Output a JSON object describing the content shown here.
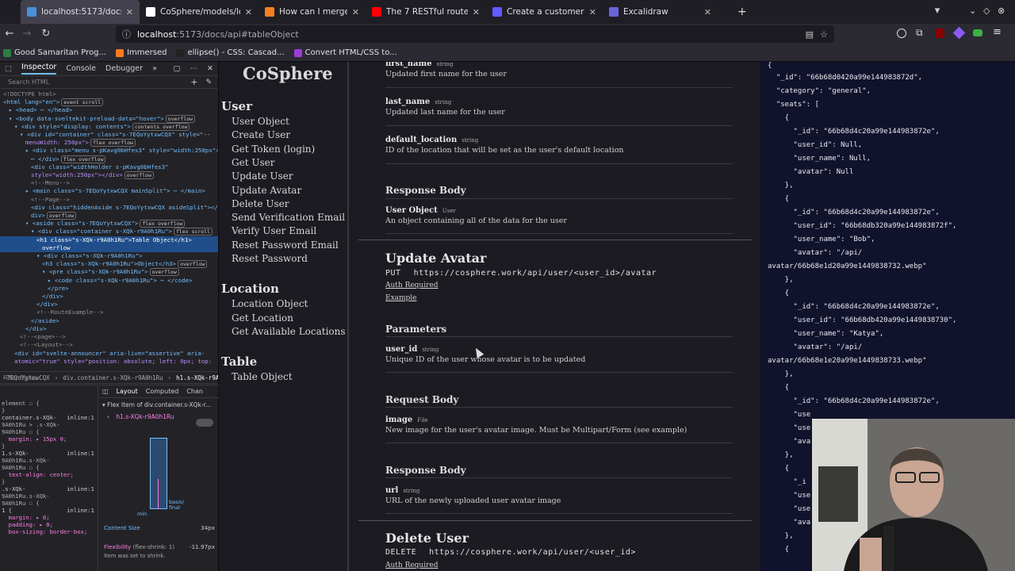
{
  "tabs": [
    {
      "title": "localhost:5173/docs/api#t",
      "color": "#4a90d9"
    },
    {
      "title": "CoSphere/models/location",
      "color": "#ffffff"
    },
    {
      "title": "How can I merge properti",
      "color": "#f48024"
    },
    {
      "title": "The 7 RESTful routes! Wha",
      "color": "#ff0000"
    },
    {
      "title": "Create a customer | Stripe",
      "color": "#635bff"
    },
    {
      "title": "Excalidraw",
      "color": "#6965db"
    }
  ],
  "url": {
    "host": "localhost",
    "path": ":5173/docs/api#tableObject"
  },
  "bookmarks": [
    "Good Samaritan Prog...",
    "Immersed",
    "ellipse() - CSS: Cascad...",
    "Convert HTML/CSS to..."
  ],
  "devtools": {
    "tabs": [
      "Inspector",
      "Console",
      "Debugger"
    ],
    "search_placeholder": "Search HTML",
    "dom_lines": [
      {
        "t": "<!DOCTYPE html>",
        "c": "cm",
        "i": 0
      },
      {
        "t": "<html lang=\"en\">",
        "c": "tg",
        "i": 0,
        "b": "event scroll"
      },
      {
        "t": "▸ <head> ⋯ </head>",
        "c": "tg",
        "i": 1
      },
      {
        "t": "▾ <body data-sveltekit-preload-data=\"hover\">",
        "c": "tg",
        "i": 1,
        "b": "overflow"
      },
      {
        "t": "▾ <div style=\"display: contents\">",
        "c": "tg",
        "i": 2,
        "b": "contents overflow"
      },
      {
        "t": "▾ <div id=\"container\" class=\"s-7EQoYytxwCQX\" style=\"--",
        "c": "tg",
        "i": 3
      },
      {
        "t": "menuWidth: 250px\">",
        "c": "av",
        "i": 4,
        "b": "flex overflow"
      },
      {
        "t": "▸ <div class=\"menu s-pKavg0bHfes3\" style=\"width:250px\">",
        "c": "tg",
        "i": 4
      },
      {
        "t": "⋯ </div>",
        "c": "tg",
        "i": 5,
        "b": "flex overflow"
      },
      {
        "t": "<div class=\"widthHolder s-pKavg0bHfes3\"",
        "c": "tg",
        "i": 5
      },
      {
        "t": "style=\"width:250px\"></div>",
        "c": "av",
        "i": 5,
        "b": "overflow"
      },
      {
        "t": "<!--Menu-->",
        "c": "cm",
        "i": 5
      },
      {
        "t": "▸ <main class=\"s-7EQoYytxwCQX mainSplit\"> ⋯ </main>",
        "c": "tg",
        "i": 4
      },
      {
        "t": "<!--Page-->",
        "c": "cm",
        "i": 5
      },
      {
        "t": "<div class=\"hiddenAside s-7EQoYytxwCQX asideSplit\"></",
        "c": "tg",
        "i": 5
      },
      {
        "t": "div>",
        "c": "tg",
        "i": 5,
        "b": "overflow"
      },
      {
        "t": "▾ <aside class=\"s-7EQoYytxwCQX\">",
        "c": "tg",
        "i": 4,
        "b": "flex overflow"
      },
      {
        "t": "▾ <div class=\"container s-XQk-r9A0h1Ru\">",
        "c": "tg",
        "i": 5,
        "b": "flex scroll"
      },
      {
        "t": "<h1 class=\"s-XQk-r9A0h1Ru\">Table Object</h1>",
        "c": "tg",
        "i": 6,
        "sel": true
      },
      {
        "t": "overflow",
        "c": "tg",
        "i": 7,
        "sel": true
      },
      {
        "t": "▾ <div class=\"s-XQk-r9A0h1Ru\">",
        "c": "tg",
        "i": 6
      },
      {
        "t": "<h3 class=\"s-XQk-r9A0h1Ru\">Object</h3>",
        "c": "tg",
        "i": 7,
        "b": "overflow"
      },
      {
        "t": "▾ <pre class=\"s-XQk-r9A0h1Ru\">",
        "c": "tg",
        "i": 7,
        "b": "overflow"
      },
      {
        "t": "▸ <code class=\"s-XQk-r9A0h1Ru\"> ⋯ </code>",
        "c": "tg",
        "i": 8
      },
      {
        "t": "</pre>",
        "c": "tg",
        "i": 8
      },
      {
        "t": "</div>",
        "c": "tg",
        "i": 7
      },
      {
        "t": "</div>",
        "c": "tg",
        "i": 6
      },
      {
        "t": "<!--RouteExample-->",
        "c": "cm",
        "i": 6
      },
      {
        "t": "</aside>",
        "c": "tg",
        "i": 5
      },
      {
        "t": "</div>",
        "c": "tg",
        "i": 4
      },
      {
        "t": "<!--<page>-->",
        "c": "cm",
        "i": 3
      },
      {
        "t": "<!--<Layout>-->",
        "c": "cm",
        "i": 3
      },
      {
        "t": "<div id=\"svelte-announcer\" aria-live=\"assertive\" aria-",
        "c": "tg",
        "i": 2
      },
      {
        "t": "atomic=\"true\" style=\"position: absolute; left: 0px; top:",
        "c": "av",
        "i": 2
      }
    ],
    "breadcrumbs": [
      "-7EQoYytxwCQX",
      "div.container.s-XQk-r9A0h1Ru",
      "h1.s-XQk-r9A0h1Ru"
    ],
    "filter_placeholder": "Filter Styles",
    "layout_tabs": [
      "Layout",
      "Computed",
      "Chan"
    ],
    "flex_item_label": "Flex Item of div.container.s-XQk-r...",
    "flex_item_selector": "h1.s-XQk-r9A0h1Ru",
    "content_size_label": "Content Size",
    "content_size_value": "34px",
    "flexibility_label": "Flexibility",
    "flexibility_detail": "(flex-shrink: 1)",
    "flexibility_value": "-11.97px",
    "flexibility_note": "Item was set to shrink.",
    "basis_label": "basis/",
    "final_label": "final",
    "min_label": "min",
    "rules": [
      "element ☐ {",
      "}",
      "container.s-XQk-   inline:1",
      "9A0h1Ru > .s-XQk-",
      "9A0h1Ru ☐ {",
      "  margin: ▸ 15px 0;",
      "}",
      "1.s-XQk-           inline:1",
      "9A0h1Ru.s-XQk-",
      "9A0h1Ru ☐ {",
      "  text-align: center;",
      "}",
      ".s-XQk-            inline:1",
      "9A0h1Ru.s-XQk-",
      "9A0h1Ru ☐ {",
      "",
      "1 {                inline:1",
      "  margin: ▸ 0;",
      "  padding: ▸ 0;",
      "  box-sizing: border-box;"
    ]
  },
  "sidebar": {
    "brand": "CoSphere",
    "sections": [
      {
        "title": "User",
        "items": [
          "User Object",
          "Create User",
          "Get Token (login)",
          "Get User",
          "Update User",
          "Update Avatar",
          "Delete User",
          "Send Verification Email",
          "Verify User Email",
          "Reset Password Email",
          "Reset Password"
        ]
      },
      {
        "title": "Location",
        "items": [
          "Location Object",
          "Get Location",
          "Get Available Locations"
        ]
      },
      {
        "title": "Table",
        "items": [
          "Table Object"
        ]
      }
    ]
  },
  "main": {
    "top_fields": [
      {
        "name": "first_name",
        "type": "string",
        "desc": "Updated first name for the user"
      },
      {
        "name": "last_name",
        "type": "string",
        "desc": "Updated last name for the user"
      },
      {
        "name": "default_location",
        "type": "string",
        "desc": "ID of the location that will be set as the user's default location"
      }
    ],
    "response_body_1": {
      "header": "Response Body",
      "name": "User Object",
      "type": "User",
      "desc": "An object containing all of the data for the user"
    },
    "update_avatar": {
      "title": "Update Avatar",
      "method": "PUT",
      "url": "https://cosphere.work/api/user/<user_id>/avatar",
      "auth": "Auth Required",
      "example": "Example",
      "params_header": "Parameters",
      "param": {
        "name": "user_id",
        "type": "string",
        "desc": "Unique ID of the user whose avatar is to be updated"
      },
      "request_header": "Request Body",
      "request": {
        "name": "image",
        "type": "File",
        "desc": "New image for the user's avatar image. Must be Multipart/Form (see example)"
      },
      "response_header": "Response Body",
      "response": {
        "name": "url",
        "type": "string",
        "desc": "URL of the newly uploaded user avatar image"
      }
    },
    "delete_user": {
      "title": "Delete User",
      "method": "DELETE",
      "url": "https://cosphere.work/api/user/<user_id>",
      "auth": "Auth Required"
    }
  },
  "json_lines": [
    "{",
    "  \"_id\": \"66b68d0420a99e144983872d\",",
    "  \"category\": \"general\",",
    "  \"seats\": [",
    "    {",
    "      \"_id\": \"66b68d4c20a99e144983872e\",",
    "      \"user_id\": Null,",
    "      \"user_name\": Null,",
    "      \"avatar\": Null",
    "    },",
    "    {",
    "      \"_id\": \"66b68d4c20a99e144983872e\",",
    "      \"user_id\": \"66b68db320a99e144983872f\",",
    "      \"user_name\": \"Bob\",",
    "      \"avatar\": \"/api/",
    "avatar/66b68e1d20a99e1449838732.webp\"",
    "    },",
    "    {",
    "      \"_id\": \"66b68d4c20a99e144983872e\",",
    "      \"user_id\": \"66b68db420a99e1449838730\",",
    "      \"user_name\": \"Katya\",",
    "      \"avatar\": \"/api/",
    "avatar/66b68e1e20a99e1449838733.webp\"",
    "    },",
    "    {",
    "      \"_id\": \"66b68d4c20a99e144983872e\",",
    "      \"use",
    "      \"use",
    "      \"ava",
    "    },",
    "    {",
    "      \"_i",
    "      \"use",
    "      \"use",
    "      \"ava",
    "    },",
    "    {"
  ]
}
